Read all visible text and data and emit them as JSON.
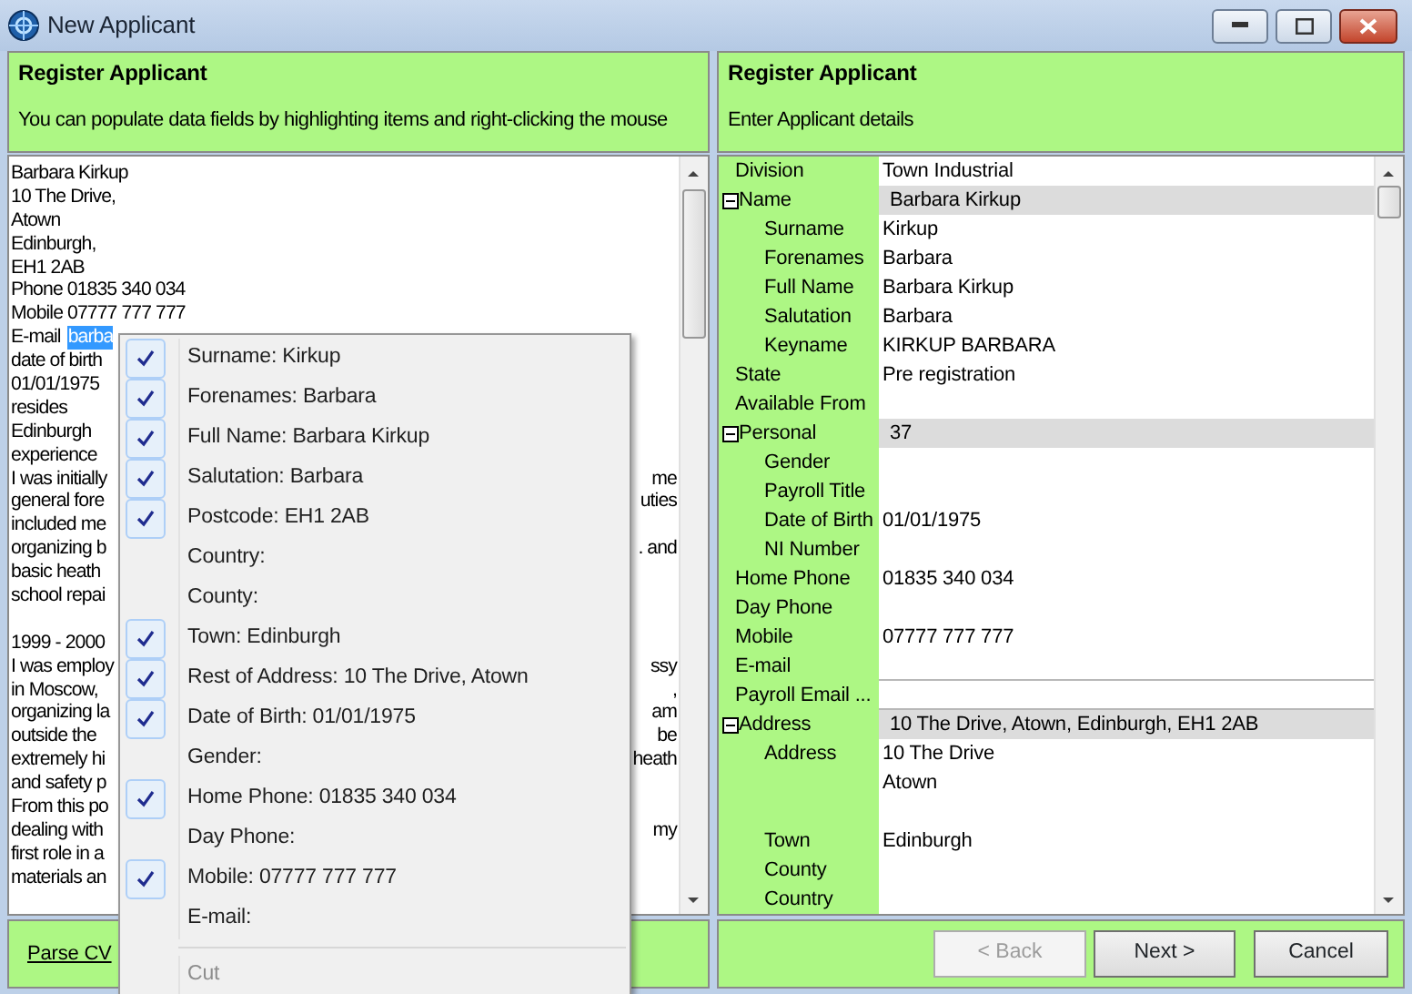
{
  "window": {
    "title": "New Applicant"
  },
  "left_panel": {
    "heading": "Register Applicant",
    "instruction": "You can populate data fields by highlighting items and right-clicking the mouse",
    "cv_lines": [
      {
        "text": "Barbara Kirkup"
      },
      {
        "text": "10 The Drive,"
      },
      {
        "text": "Atown"
      },
      {
        "text": "Edinburgh,"
      },
      {
        "text": "EH1 2AB"
      },
      {
        "text": "Phone 01835 340 034"
      },
      {
        "text": "Mobile 07777 777 777"
      },
      {
        "text": "E-mail",
        "selection": "barba"
      },
      {
        "text": "date of birth"
      },
      {
        "text": "01/01/1975"
      },
      {
        "text": "resides"
      },
      {
        "text": "Edinburgh"
      },
      {
        "text": "experience"
      },
      {
        "text": "I was initially",
        "tail": "me"
      },
      {
        "text": "general fore",
        "tail": "uties"
      },
      {
        "text": "included me"
      },
      {
        "text": "organizing b",
        "tail": ". and"
      },
      {
        "text": "basic heath"
      },
      {
        "text": "school repai"
      },
      {
        "text": "1999 - 2000",
        "paragraph_start": true
      },
      {
        "text": "I was employ",
        "tail": "ssy"
      },
      {
        "text": "in Moscow,",
        "tail": ","
      },
      {
        "text": "organizing la",
        "tail": "am"
      },
      {
        "text": "outside the",
        "tail": "be"
      },
      {
        "text": "extremely hi",
        "tail": "heath"
      },
      {
        "text": "and safety p"
      },
      {
        "text": "From this po"
      },
      {
        "text": "dealing with",
        "tail": "my"
      },
      {
        "text": "first role in a"
      },
      {
        "text": "materials an"
      }
    ],
    "link": "Parse CV"
  },
  "context_menu": {
    "items": [
      {
        "kind": "field",
        "label": "Surname: Kirkup",
        "checked": true
      },
      {
        "kind": "field",
        "label": "Forenames: Barbara",
        "checked": true
      },
      {
        "kind": "field",
        "label": "Full Name: Barbara Kirkup",
        "checked": true
      },
      {
        "kind": "field",
        "label": "Salutation: Barbara",
        "checked": true
      },
      {
        "kind": "field",
        "label": "Postcode: EH1 2AB",
        "checked": true
      },
      {
        "kind": "field",
        "label": "Country:",
        "checked": false
      },
      {
        "kind": "field",
        "label": "County:",
        "checked": false
      },
      {
        "kind": "field",
        "label": "Town: Edinburgh",
        "checked": true
      },
      {
        "kind": "field",
        "label": "Rest of Address: 10 The Drive, Atown",
        "checked": true
      },
      {
        "kind": "field",
        "label": "Date of Birth: 01/01/1975",
        "checked": true
      },
      {
        "kind": "field",
        "label": "Gender:",
        "checked": false
      },
      {
        "kind": "field",
        "label": "Home Phone: 01835 340 034",
        "checked": true
      },
      {
        "kind": "field",
        "label": "Day Phone:",
        "checked": false
      },
      {
        "kind": "field",
        "label": "Mobile: 07777 777 777",
        "checked": true
      },
      {
        "kind": "field",
        "label": "E-mail:",
        "checked": false
      },
      {
        "kind": "separator"
      },
      {
        "kind": "command",
        "label": "Cut",
        "disabled": true
      }
    ]
  },
  "right_panel": {
    "heading": "Register Applicant",
    "instruction": "Enter Applicant details",
    "properties": [
      {
        "label": "Division",
        "value": "Town Industrial"
      },
      {
        "label": "Name",
        "value": "Barbara Kirkup",
        "expanded": true,
        "children": [
          {
            "label": "Surname",
            "value": "Kirkup"
          },
          {
            "label": "Forenames",
            "value": "Barbara"
          },
          {
            "label": "Full Name",
            "value": "Barbara Kirkup"
          },
          {
            "label": "Salutation",
            "value": "Barbara"
          },
          {
            "label": "Keyname",
            "value": "KIRKUP BARBARA"
          }
        ]
      },
      {
        "label": "State",
        "value": "Pre registration"
      },
      {
        "label": "Available From"
      },
      {
        "label": "Personal",
        "value": "37",
        "expanded": true,
        "children": [
          {
            "label": "Gender"
          },
          {
            "label": "Payroll Title"
          },
          {
            "label": "Date of Birth",
            "value": "01/01/1975"
          },
          {
            "label": "NI Number"
          }
        ]
      },
      {
        "label": "Home Phone",
        "value": "01835 340 034"
      },
      {
        "label": "Day Phone"
      },
      {
        "label": "Mobile",
        "value": "07777 777 777"
      },
      {
        "label": "E-mail",
        "kind": "edit"
      },
      {
        "label": "Payroll Email ...",
        "kind": "edit"
      },
      {
        "label": "Address",
        "value": "10 The Drive, Atown, Edinburgh, EH1 2AB",
        "expanded": true,
        "children": [
          {
            "label": "Address",
            "kind": "memo",
            "value_lines": [
              "10 The Drive",
              "Atown"
            ]
          },
          {
            "label": "Town",
            "value": "Edinburgh"
          },
          {
            "label": "County"
          },
          {
            "label": "Country"
          }
        ]
      }
    ]
  },
  "buttons": [
    {
      "label": "< Back",
      "disabled": true
    },
    {
      "label": "Next >",
      "disabled": false
    },
    {
      "label": "Cancel",
      "disabled": false
    }
  ]
}
